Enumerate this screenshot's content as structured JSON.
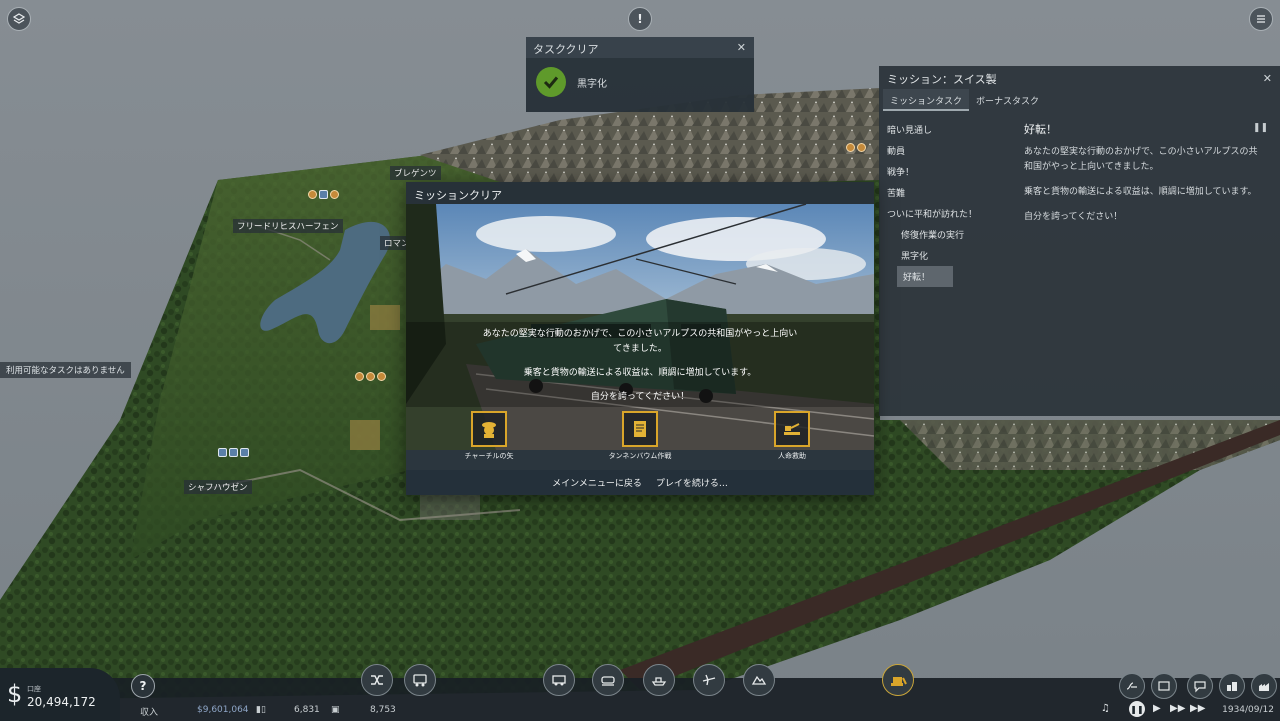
{
  "top_icons": [
    "layers-icon",
    "alert-icon",
    "menu-icon"
  ],
  "task_cleared": {
    "title": "タスククリア",
    "task": "黒字化"
  },
  "mission_panel": {
    "title": "ミッション：スイス製",
    "tabs": [
      "ミッションタスク",
      "ボーナスタスク"
    ],
    "tasks": [
      {
        "label": "暗い見通し",
        "sub": false
      },
      {
        "label": "動員",
        "sub": false
      },
      {
        "label": "戦争！",
        "sub": false
      },
      {
        "label": "苦難",
        "sub": false
      },
      {
        "label": "ついに平和が訪れた！",
        "sub": false
      },
      {
        "label": "修復作業の実行",
        "sub": true
      },
      {
        "label": "黒字化",
        "sub": true
      },
      {
        "label": "好転！",
        "sub": true,
        "selected": true
      }
    ],
    "detail_title": "好転！",
    "detail_paragraphs": [
      "あなたの堅実な行動のおかげで、この小さいアルプスの共和国がやっと上向いてきました。",
      "乗客と貨物の輸送による収益は、順調に増加しています。",
      "自分を誇ってください！"
    ]
  },
  "mission_clear": {
    "title": "ミッションクリア",
    "text_line1a": "あなたの堅実な行動のおかげで、この小さいアルプスの共和国がやっと上向い",
    "text_line1b": "てきました。",
    "text_line2": "乗客と貨物の輸送による収益は、順調に増加しています。",
    "text_line3": "自分を誇ってください！",
    "rewards": [
      {
        "label": "チャーチルの矢",
        "icon": "churchill-icon"
      },
      {
        "label": "タンネンバウム作戦",
        "icon": "document-icon"
      },
      {
        "label": "人命救助",
        "icon": "rescue-icon"
      }
    ],
    "footer_buttons": [
      "メインメニューに戻る",
      "プレイを続ける…"
    ]
  },
  "map_labels": {
    "town1": "フリードリヒスハーフェン",
    "town2": "シャフハウゼン",
    "town3": "ブレゲンツ",
    "town4": "ロマンス"
  },
  "no_tasks_message": "利用可能なタスクはありません",
  "bottom_bar": {
    "money_label": "口座",
    "money": "20,494,172",
    "income_label": "収入",
    "income": "$9,601,064",
    "passengers": "6,831",
    "cargo": "8,753",
    "date": "1934/09/12"
  },
  "colors": {
    "panel_bg": "#2c343a",
    "check_green": "#5f9a2b",
    "reward_gold": "#d9a52a",
    "income_blue": "#8fa6c7"
  }
}
